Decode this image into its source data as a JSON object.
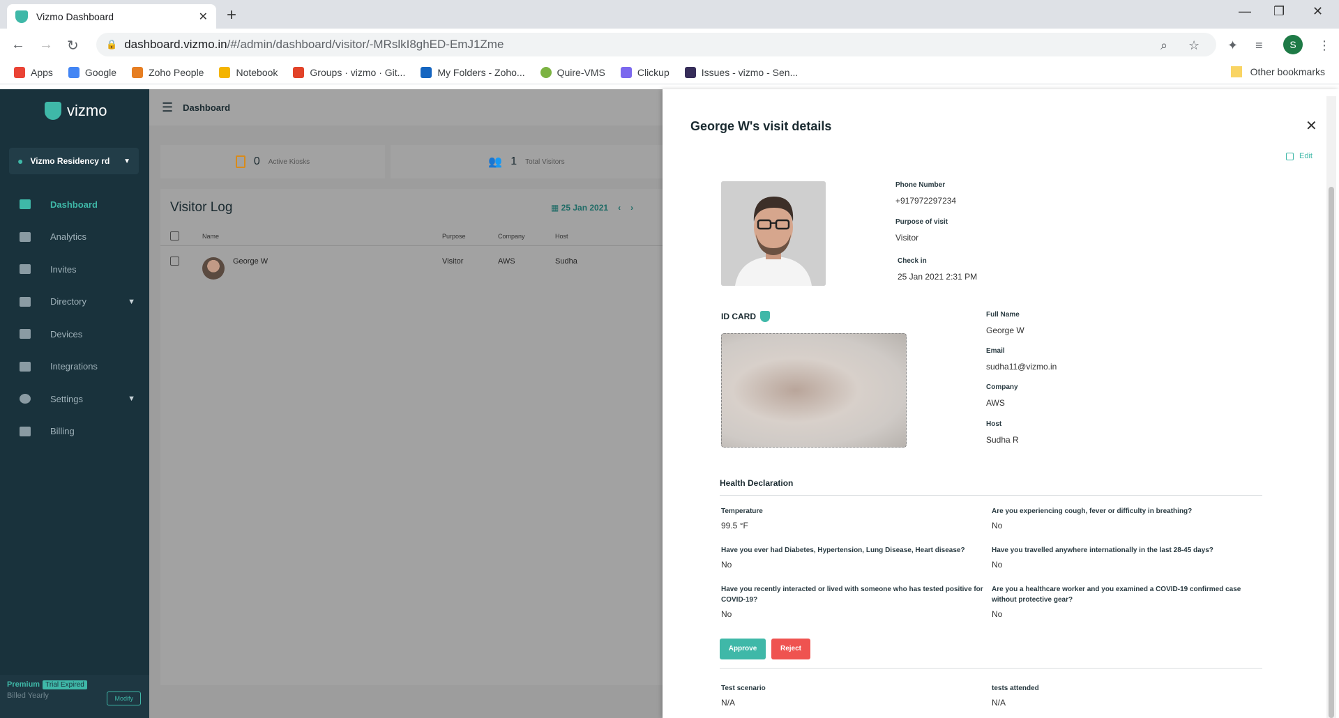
{
  "browser": {
    "tab_title": "Vizmo Dashboard",
    "url_host": "dashboard.vizmo.in",
    "url_path": "/#/admin/dashboard/visitor/-MRslkI8ghED-EmJ1Zme",
    "profile_initial": "S",
    "bookmarks": [
      {
        "label": "Apps",
        "color": "#ea4335"
      },
      {
        "label": "Google",
        "color": "#4285f4"
      },
      {
        "label": "Zoho People",
        "color": "#e67e22"
      },
      {
        "label": "Notebook",
        "color": "#f4b400"
      },
      {
        "label": "Groups · vizmo · Git...",
        "color": "#e24329"
      },
      {
        "label": "My Folders - Zoho...",
        "color": "#1565c0"
      },
      {
        "label": "Quire-VMS",
        "color": "#7cb342"
      },
      {
        "label": "Clickup",
        "color": "#7b68ee"
      },
      {
        "label": "Issues - vizmo - Sen...",
        "color": "#362d59"
      }
    ],
    "other_bookmarks": "Other bookmarks"
  },
  "sidebar": {
    "brand": "vizmo",
    "location": "Vizmo Residency rd",
    "items": [
      {
        "label": "Dashboard",
        "active": true
      },
      {
        "label": "Analytics"
      },
      {
        "label": "Invites"
      },
      {
        "label": "Directory",
        "caret": true
      },
      {
        "label": "Devices"
      },
      {
        "label": "Integrations"
      },
      {
        "label": "Settings",
        "caret": true
      },
      {
        "label": "Billing"
      }
    ],
    "plan": {
      "name": "Premium",
      "badge": "Trial Expired",
      "billing": "Billed Yearly",
      "modify": "Modify"
    }
  },
  "main": {
    "header": "Dashboard",
    "stats": [
      {
        "value": "0",
        "label": "Active Kiosks"
      },
      {
        "value": "1",
        "label": "Total Visitors"
      }
    ],
    "log": {
      "title": "Visitor Log",
      "date": "25 Jan 2021",
      "columns": [
        "Name",
        "Purpose",
        "Company",
        "Host"
      ],
      "rows": [
        {
          "name": "George W",
          "purpose": "Visitor",
          "company": "AWS",
          "host": "Sudha"
        }
      ]
    }
  },
  "drawer": {
    "title": "George W's visit details",
    "edit": "Edit",
    "phone_label": "Phone Number",
    "phone": "+917972297234",
    "purpose_label": "Purpose of visit",
    "purpose": "Visitor",
    "checkin_label": "Check in",
    "checkin": "25 Jan 2021 2:31 PM",
    "idcard_label": "ID CARD",
    "fullname_label": "Full Name",
    "fullname": "George W",
    "email_label": "Email",
    "email": "sudha11@vizmo.in",
    "company_label": "Company",
    "company": "AWS",
    "host_label": "Host",
    "host": "Sudha R",
    "health_title": "Health Declaration",
    "questions": [
      {
        "q": "Temperature",
        "a": "99.5 °F"
      },
      {
        "q": "Are you experiencing cough, fever or difficulty in breathing?",
        "a": "No"
      },
      {
        "q": "Have you ever had Diabetes, Hypertension, Lung Disease, Heart disease?",
        "a": "No"
      },
      {
        "q": "Have you travelled anywhere internationally in the last 28-45 days?",
        "a": "No"
      },
      {
        "q": "Have you recently interacted or lived with someone who has tested positive for COVID-19?",
        "a": "No"
      },
      {
        "q": "Are you a healthcare worker and you examined a COVID-19 confirmed case without protective gear?",
        "a": "No"
      }
    ],
    "approve": "Approve",
    "reject": "Reject",
    "extra": [
      {
        "q": "Test scenario",
        "a": "N/A"
      },
      {
        "q": "tests attended",
        "a": "N/A"
      }
    ]
  }
}
